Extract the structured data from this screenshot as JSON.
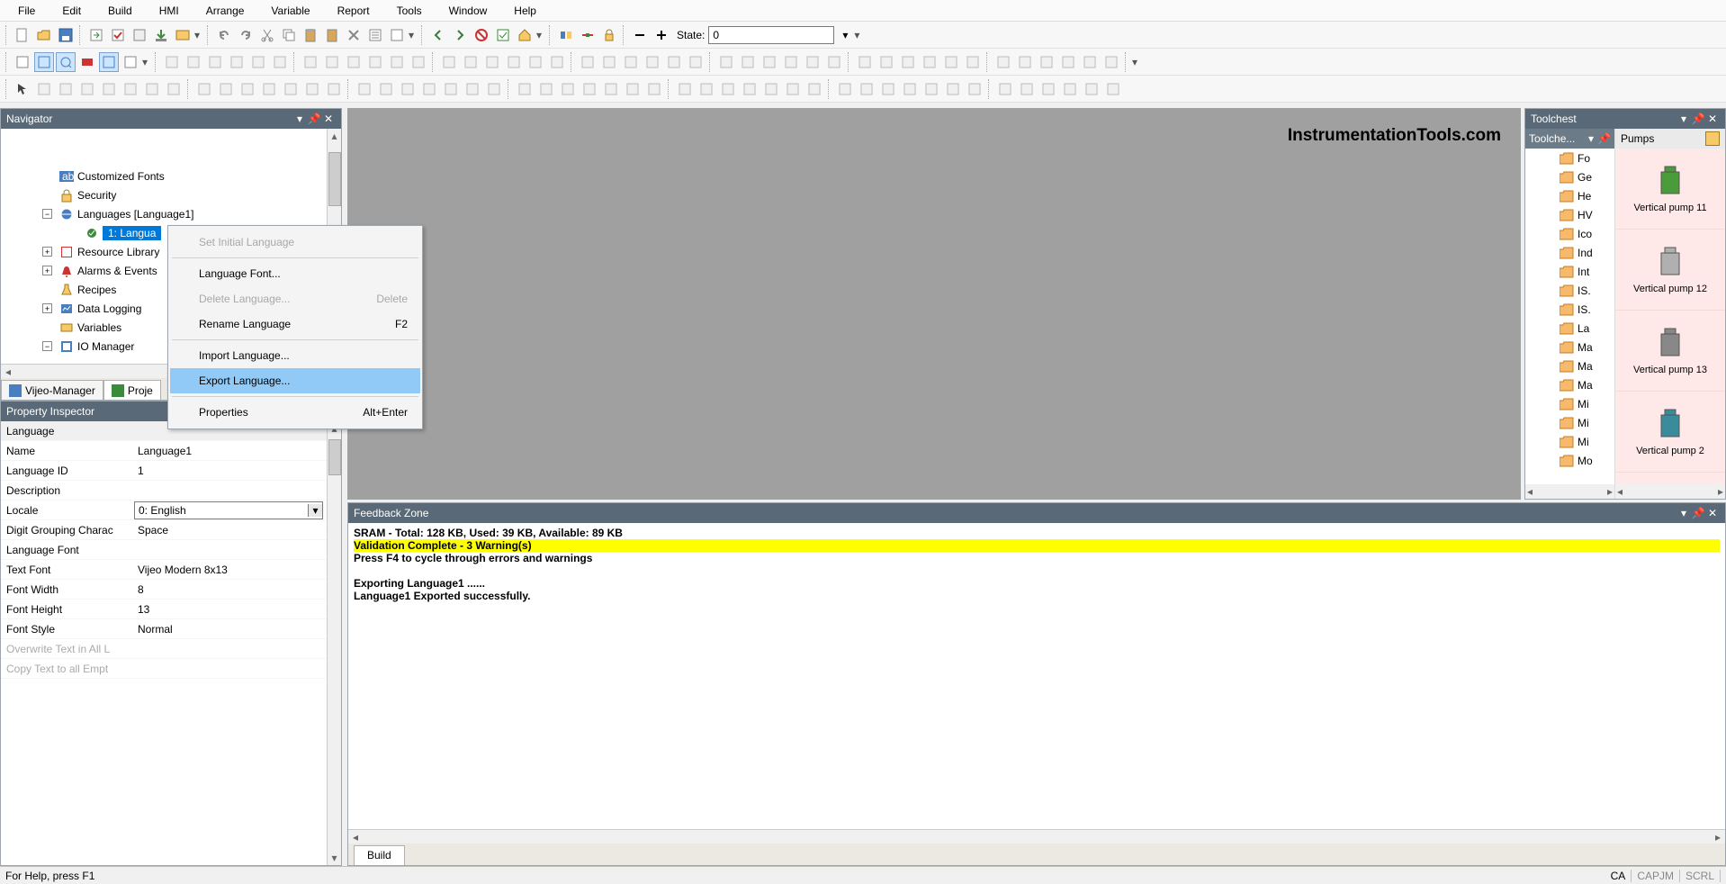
{
  "menu": [
    "File",
    "Edit",
    "Build",
    "HMI",
    "Arrange",
    "Variable",
    "Report",
    "Tools",
    "Window",
    "Help"
  ],
  "state": {
    "label": "State:",
    "value": "0"
  },
  "watermark": "InstrumentationTools.com",
  "navigator": {
    "title": "Navigator",
    "items": [
      {
        "icon": "ab",
        "label": "Customized Fonts",
        "indent": 0,
        "exp": ""
      },
      {
        "icon": "lock",
        "label": "Security",
        "indent": 0,
        "exp": ""
      },
      {
        "icon": "lang",
        "label": "Languages [Language1]",
        "indent": 0,
        "exp": "minus"
      },
      {
        "icon": "lang-leaf",
        "label": "1: Langua",
        "indent": 1,
        "exp": "",
        "selected": true
      },
      {
        "icon": "book",
        "label": "Resource Library",
        "indent": 0,
        "exp": "plus"
      },
      {
        "icon": "alarm",
        "label": "Alarms & Events",
        "indent": 0,
        "exp": "plus"
      },
      {
        "icon": "flask",
        "label": "Recipes",
        "indent": 0,
        "exp": ""
      },
      {
        "icon": "datalog",
        "label": "Data Logging",
        "indent": 0,
        "exp": "plus"
      },
      {
        "icon": "var",
        "label": "Variables",
        "indent": 0,
        "exp": ""
      },
      {
        "icon": "io",
        "label": "IO Manager",
        "indent": 0,
        "exp": "minus"
      }
    ],
    "tabs": [
      {
        "label": "Vijeo-Manager",
        "active": false
      },
      {
        "label": "Proje",
        "active": true
      }
    ]
  },
  "context_menu": [
    {
      "label": "Set Initial Language",
      "disabled": true
    },
    {
      "sep": true
    },
    {
      "label": "Language Font..."
    },
    {
      "label": "Delete Language...",
      "shortcut": "Delete",
      "disabled": true
    },
    {
      "label": "Rename Language",
      "shortcut": "F2"
    },
    {
      "sep": true
    },
    {
      "label": "Import Language..."
    },
    {
      "label": "Export Language...",
      "highlight": true
    },
    {
      "sep": true
    },
    {
      "label": "Properties",
      "shortcut": "Alt+Enter"
    }
  ],
  "prop_inspector": {
    "title": "Property Inspector",
    "header": "Language",
    "rows": [
      {
        "label": "Name",
        "value": "Language1"
      },
      {
        "label": "Language ID",
        "value": "1"
      },
      {
        "label": "Description",
        "value": ""
      },
      {
        "label": "Locale",
        "value": "0: English",
        "dropdown": true
      },
      {
        "label": "Digit Grouping Charac",
        "value": "Space"
      },
      {
        "label": "Language Font",
        "value": ""
      },
      {
        "label": "Text Font",
        "value": "Vijeo Modern 8x13"
      },
      {
        "label": "Font Width",
        "value": "8"
      },
      {
        "label": "Font Height",
        "value": "13"
      },
      {
        "label": "Font Style",
        "value": "Normal"
      },
      {
        "label": "Overwrite Text in All L",
        "value": "",
        "dim": true
      },
      {
        "label": "Copy Text to all Empt",
        "value": "",
        "dim": true
      }
    ]
  },
  "toolchest": {
    "title": "Toolchest",
    "left_header": "Toolche...",
    "right_header": "Pumps",
    "folders": [
      "Fo",
      "Ge",
      "He",
      "HV",
      "Ico",
      "Ind",
      "Int",
      "IS.",
      "IS.",
      "La",
      "Ma",
      "Ma",
      "Ma",
      "Mi",
      "Mi",
      "Mi",
      "Mo"
    ],
    "items": [
      {
        "name": "Vertical pump 11",
        "color": "#4a9b3a"
      },
      {
        "name": "Vertical pump 12",
        "color": "#b0b0b0"
      },
      {
        "name": "Vertical pump 13",
        "color": "#888"
      },
      {
        "name": "Vertical pump 2",
        "color": "#3a8b9b"
      }
    ]
  },
  "feedback": {
    "title": "Feedback Zone",
    "lines": [
      {
        "text": "SRAM - Total: 128 KB, Used: 39 KB, Available: 89 KB"
      },
      {
        "text": "Validation Complete - 3 Warning(s)",
        "highlight": true
      },
      {
        "text": "Press F4 to cycle through errors and warnings"
      },
      {
        "text": ""
      },
      {
        "text": "Exporting Language1 ......"
      },
      {
        "text": "Language1 Exported successfully."
      }
    ],
    "tab": "Build"
  },
  "status": {
    "help": "For Help, press F1",
    "segs": [
      "CA",
      "CAPJM",
      "SCRL"
    ]
  }
}
